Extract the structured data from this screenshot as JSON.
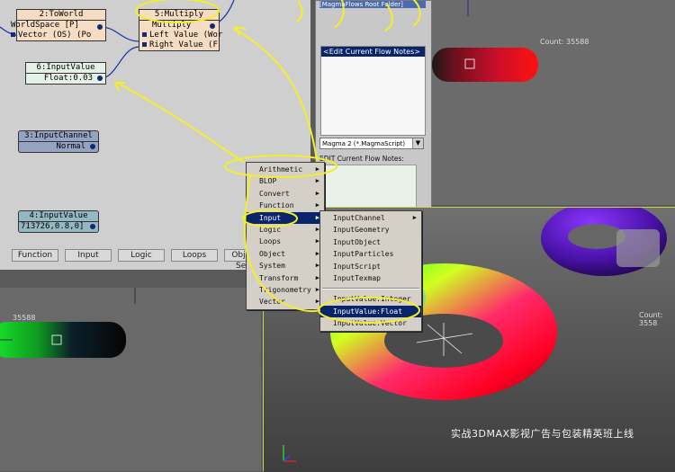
{
  "nodes": {
    "toworld": {
      "title": "2:ToWorld",
      "rows": [
        "WorldSpace [P]",
        "Vector (OS) (Po"
      ]
    },
    "multiply": {
      "title": "5:Multiply",
      "rows": [
        "Multiply",
        "Left Value (Wor",
        "Right Value (F"
      ]
    },
    "inputvalue6": {
      "title": "6:InputValue",
      "value": "Float:0.03"
    },
    "inputchannel": {
      "title": "3:InputChannel",
      "value": "Normal"
    },
    "inputvalue4": {
      "title": "4:InputValue",
      "value": "713726,0.8,0]"
    }
  },
  "category_tabs": [
    "Function",
    "Input",
    "Logic",
    "Loops",
    "Obj"
  ],
  "category_tab_extra": "Se",
  "panel": {
    "root_folder": "[MagmaFlows Root Folder]",
    "edit_notes_item": "<Edit Current Flow Notes>",
    "script_select": "Magma 2 (*.MagmaScript)",
    "edit_notes_label": "EDIT Current Flow Notes:"
  },
  "viewports": {
    "top_count": "Count: 35588",
    "left_count": "35588",
    "right_count": "Count: 3558"
  },
  "watermark": "实战3DMAX影视广告与包装精英班上线",
  "context_menu": {
    "items": [
      "Arithmetic",
      "BLOP",
      "Convert",
      "Function",
      "Input",
      "Logic",
      "Loops",
      "Object",
      "System",
      "Transform",
      "Trigonometry",
      "Vector"
    ],
    "selected": "Input"
  },
  "submenu": {
    "group1": [
      "InputChannel",
      "InputGeometry",
      "InputObject",
      "InputParticles",
      "InputScript",
      "InputTexmap"
    ],
    "group2": [
      "InputValue:Integer",
      "InputValue:Float",
      "InputValue:Vector"
    ],
    "selected": "InputValue:Float"
  },
  "colors": {
    "menu_highlight": "#0a246a",
    "node_multiply": "#f5dcc2",
    "node_input": "#e3f1e7",
    "node_channel": "#94a3c2",
    "annotation": "#f2ef2a"
  }
}
